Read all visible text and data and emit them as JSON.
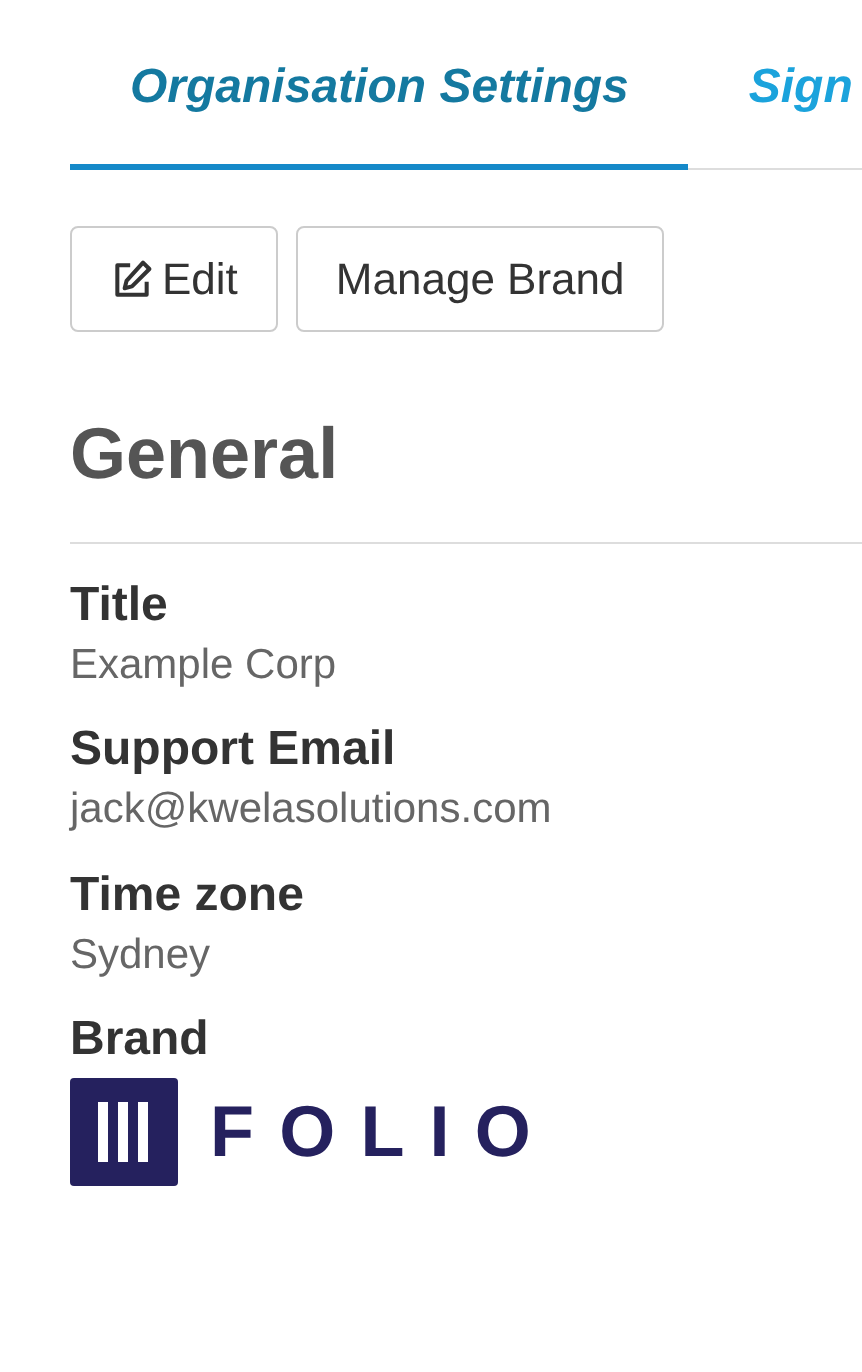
{
  "tabs": [
    {
      "label": "Organisation Settings",
      "selected": true
    },
    {
      "label": "Sign",
      "selected": false
    }
  ],
  "buttons": [
    {
      "label": "Edit",
      "kind": "edit"
    },
    {
      "label": "Manage Brand",
      "kind": "plain"
    }
  ],
  "section": {
    "title": "General"
  },
  "fields": [
    {
      "label": "Title",
      "value": "Example Corp",
      "kind": "text"
    },
    {
      "label": "Support Email",
      "value": "jack@kwelasolutions.com",
      "kind": "text"
    },
    {
      "label": "Time zone",
      "value": "Sydney",
      "kind": "text"
    },
    {
      "label": "Brand",
      "value": "FOLIO",
      "kind": "logo"
    }
  ]
}
